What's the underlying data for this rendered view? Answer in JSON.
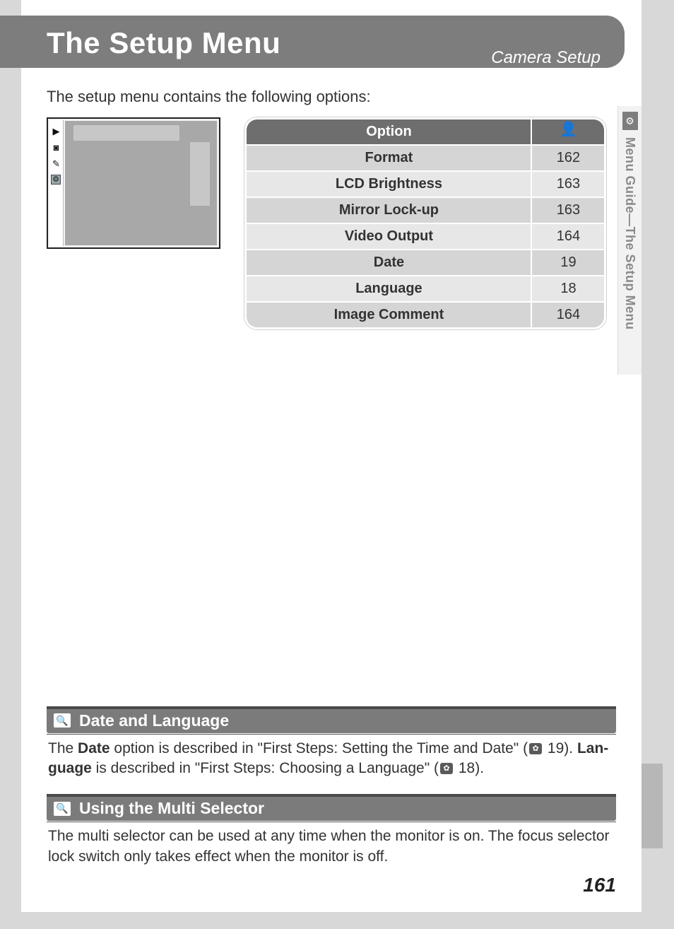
{
  "banner": {
    "title": "The Setup Menu",
    "subtitle": "Camera Setup"
  },
  "intro": "The setup menu contains the following options:",
  "lcd_icons": [
    "▶",
    "◙",
    "✎",
    "⚙"
  ],
  "table": {
    "head_option": "Option",
    "head_ref_icon": "person-icon",
    "rows": [
      {
        "option": "Format",
        "page": "162"
      },
      {
        "option": "LCD Brightness",
        "page": "163"
      },
      {
        "option": "Mirror Lock-up",
        "page": "163"
      },
      {
        "option": "Video Output",
        "page": "164"
      },
      {
        "option": "Date",
        "page": "19"
      },
      {
        "option": "Language",
        "page": "18"
      },
      {
        "option": "Image Comment",
        "page": "164"
      }
    ]
  },
  "side_tab": "Menu Guide—The Setup Menu",
  "note1": {
    "title": "Date and Language",
    "p1a": "The ",
    "p1b": "Date",
    "p1c": " option is described in \"First Steps: Setting the Time and Date\" (",
    "p1d": " 19).  ",
    "p1e": "Lan-",
    "p2a": "guage",
    "p2b": " is described in \"First Steps: Choosing a Language\" (",
    "p2c": " 18)."
  },
  "note2": {
    "title": "Using the Multi Selector",
    "body": "The multi selector can be used at any time when the monitor is on.  The focus selector lock switch only takes effect when the monitor is off."
  },
  "page_number": "161"
}
